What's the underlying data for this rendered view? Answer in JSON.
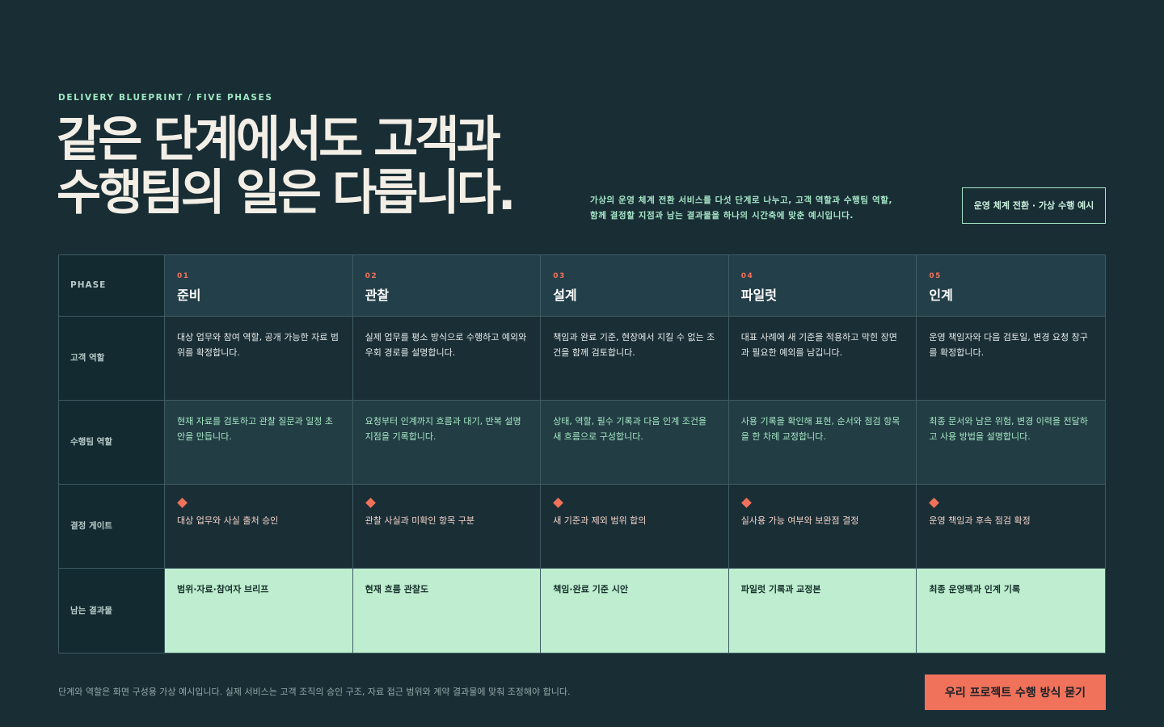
{
  "eyebrow": "DELIVERY BLUEPRINT / FIVE PHASES",
  "headline": {
    "line1": "같은 단계에서도 고객과",
    "line2": "수행팀의 일은 다릅니다."
  },
  "intro": {
    "line1": "가상의 운영 체계 전환 서비스를 다섯 단계로 나누고, 고객 역할과 수행팀 역할,",
    "line2": "함께 결정할 지점과 남는 결과물을 하나의 시간축에 맞춘 예시입니다."
  },
  "tag_button": "운영 체계 전환 · 가상 수행 예시",
  "table": {
    "phase_label": "PHASE",
    "row_labels": {
      "client": "고객 역할",
      "team": "수행팀 역할",
      "gate": "결정 게이트",
      "output": "남는 결과물"
    },
    "phases": [
      {
        "num": "01",
        "name": "준비",
        "client": "대상 업무와 참여 역할, 공개 가능한 자료 범위를 확정합니다.",
        "team": "현재 자료를 검토하고 관찰 질문과 일정 초안을 만듭니다.",
        "gate": "대상 업무와 사실 출처 승인",
        "output": "범위·자료·참여자 브리프"
      },
      {
        "num": "02",
        "name": "관찰",
        "client": "실제 업무를 평소 방식으로 수행하고 예외와 우회 경로를 설명합니다.",
        "team": "요청부터 인계까지 흐름과 대기, 반복 설명 지점을 기록합니다.",
        "gate": "관찰 사실과 미확인 항목 구분",
        "output": "현재 흐름 관찰도"
      },
      {
        "num": "03",
        "name": "설계",
        "client": "책임과 완료 기준, 현장에서 지킬 수 없는 조건을 함께 검토합니다.",
        "team": "상태, 역할, 필수 기록과 다음 인계 조건을 새 흐름으로 구성합니다.",
        "gate": "새 기준과 제외 범위 합의",
        "output": "책임·완료 기준 시안"
      },
      {
        "num": "04",
        "name": "파일럿",
        "client": "대표 사례에 새 기준을 적용하고 막힌 장면과 필요한 예외를 남깁니다.",
        "team": "사용 기록을 확인해 표현, 순서와 점검 항목을 한 차례 교정합니다.",
        "gate": "실사용 가능 여부와 보완점 결정",
        "output": "파일럿 기록과 교정본"
      },
      {
        "num": "05",
        "name": "인계",
        "client": "운영 책임자와 다음 검토일, 변경 요청 창구를 확정합니다.",
        "team": "최종 문서와 남은 위험, 변경 이력을 전달하고 사용 방법을 설명합니다.",
        "gate": "운영 책임과 후속 점검 확정",
        "output": "최종 운영팩과 인계 기록"
      }
    ]
  },
  "footnote": "단계와 역할은 화면 구성용 가상 예시입니다. 실제 서비스는 고객 조직의 승인 구조, 자료 접근 범위와 계약 결과물에 맞춰 조정해야 합니다.",
  "cta": "우리 프로젝트 수행 방식 묻기",
  "colors": {
    "background": "#192d35",
    "accent_mint": "#a6e7c6",
    "accent_coral": "#f0725a",
    "output_bg": "#beeecf"
  }
}
